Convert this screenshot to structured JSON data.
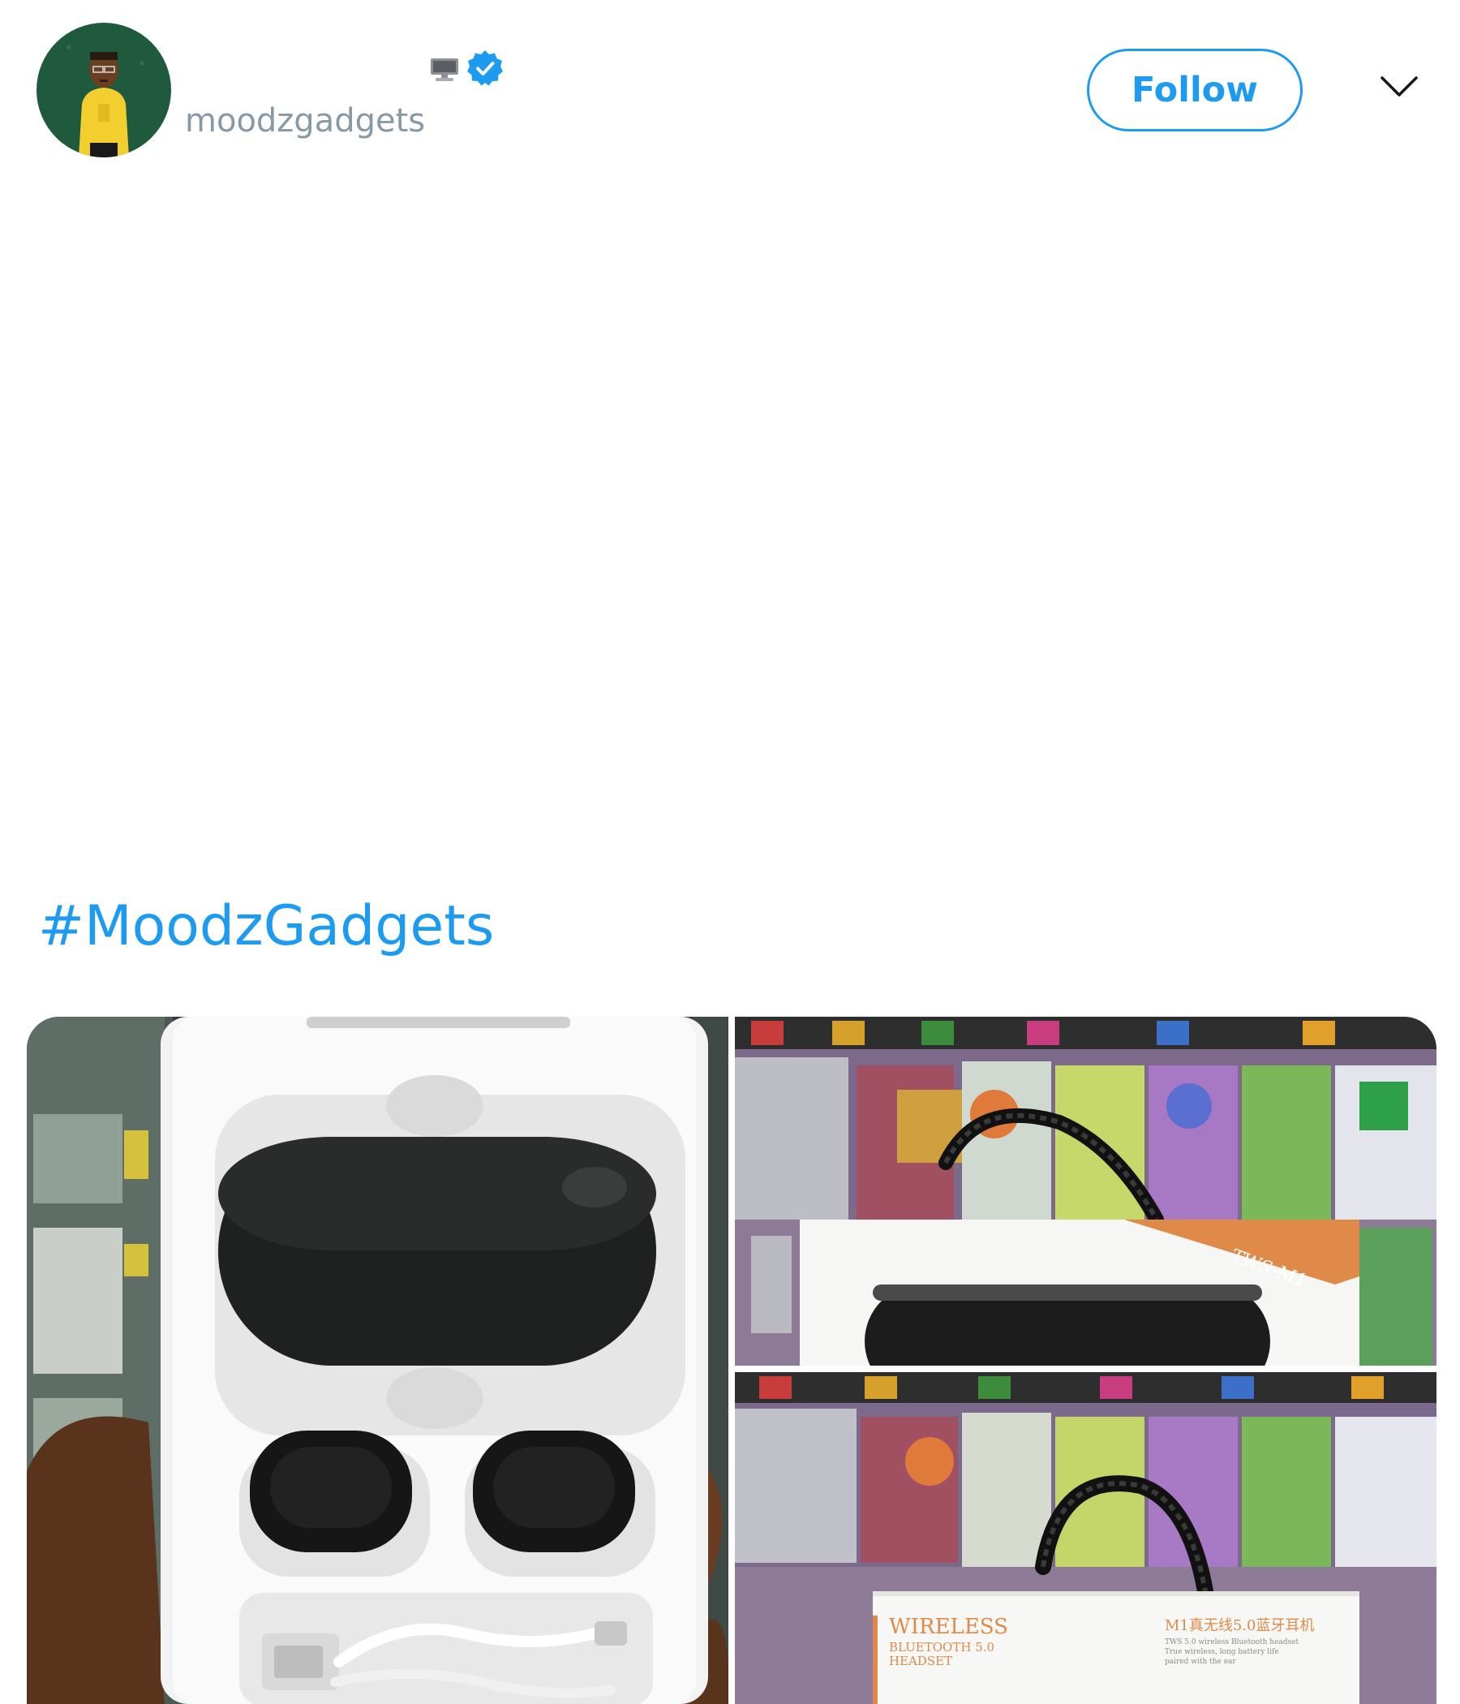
{
  "header": {
    "display_name": "",
    "handle": "moodzgadgets",
    "follow_label": "Follow",
    "verified": true
  },
  "tweet": {
    "hashtag": "#MoodzGadgets"
  },
  "media": {
    "photo_count": 3,
    "package_labels": {
      "model": "TWS-M1",
      "wireless": "WIRELESS",
      "bluetooth": "BLUETOOTH 5.0",
      "headset": "HEADSET",
      "chinese_title": "M1真无线5.0蓝牙耳机",
      "subtitle_line1": "TWS 5.0 wireless Bluetooth headset",
      "subtitle_line2": "True wireless, long battery life",
      "subtitle_line3": "paired with the ear"
    }
  },
  "colors": {
    "accent": "#1d9bf0",
    "handle": "#8899a6",
    "package_orange": "#e08a4a"
  },
  "icons": {
    "device": "computer-icon",
    "verified": "verified-badge-icon",
    "menu": "chevron-down-icon"
  }
}
